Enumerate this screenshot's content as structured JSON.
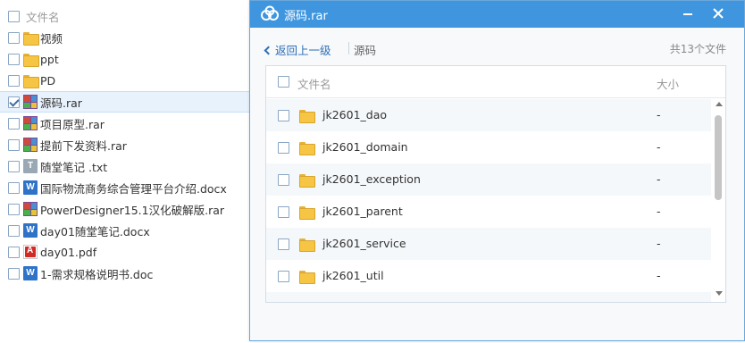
{
  "file_list": {
    "header_label": "文件名",
    "items": [
      {
        "name": "视频",
        "icon": "folder-icon",
        "checked": false
      },
      {
        "name": "ppt",
        "icon": "folder-icon",
        "checked": false
      },
      {
        "name": "PD",
        "icon": "folder-icon",
        "checked": false
      },
      {
        "name": "源码.rar",
        "icon": "rar-icon",
        "checked": true
      },
      {
        "name": "项目原型.rar",
        "icon": "rar-icon",
        "checked": false
      },
      {
        "name": "提前下发资料.rar",
        "icon": "rar-icon",
        "checked": false
      },
      {
        "name": "随堂笔记 .txt",
        "icon": "txt-icon",
        "checked": false
      },
      {
        "name": "国际物流商务综合管理平台介绍.docx",
        "icon": "word-icon",
        "checked": false
      },
      {
        "name": "PowerDesigner15.1汉化破解版.rar",
        "icon": "rar-icon",
        "checked": false
      },
      {
        "name": "day01随堂笔记.docx",
        "icon": "word-icon",
        "checked": false
      },
      {
        "name": "day01.pdf",
        "icon": "pdf-icon",
        "checked": false
      },
      {
        "name": "1-需求规格说明书.doc",
        "icon": "word-icon",
        "checked": false
      }
    ]
  },
  "dialog": {
    "title": "源码.rar",
    "back_label": "返回上一级",
    "breadcrumb": "源码",
    "count_text": "共13个文件",
    "columns": {
      "name": "文件名",
      "size": "大小"
    },
    "rows": [
      {
        "name": "jk2601_dao",
        "size": "-"
      },
      {
        "name": "jk2601_domain",
        "size": "-"
      },
      {
        "name": "jk2601_exception",
        "size": "-"
      },
      {
        "name": "jk2601_parent",
        "size": "-"
      },
      {
        "name": "jk2601_service",
        "size": "-"
      },
      {
        "name": "jk2601_util",
        "size": "-"
      }
    ],
    "colors": {
      "titlebar": "#3f96df",
      "link": "#2d6fb6",
      "selected_row": "#e8f2fc"
    }
  }
}
